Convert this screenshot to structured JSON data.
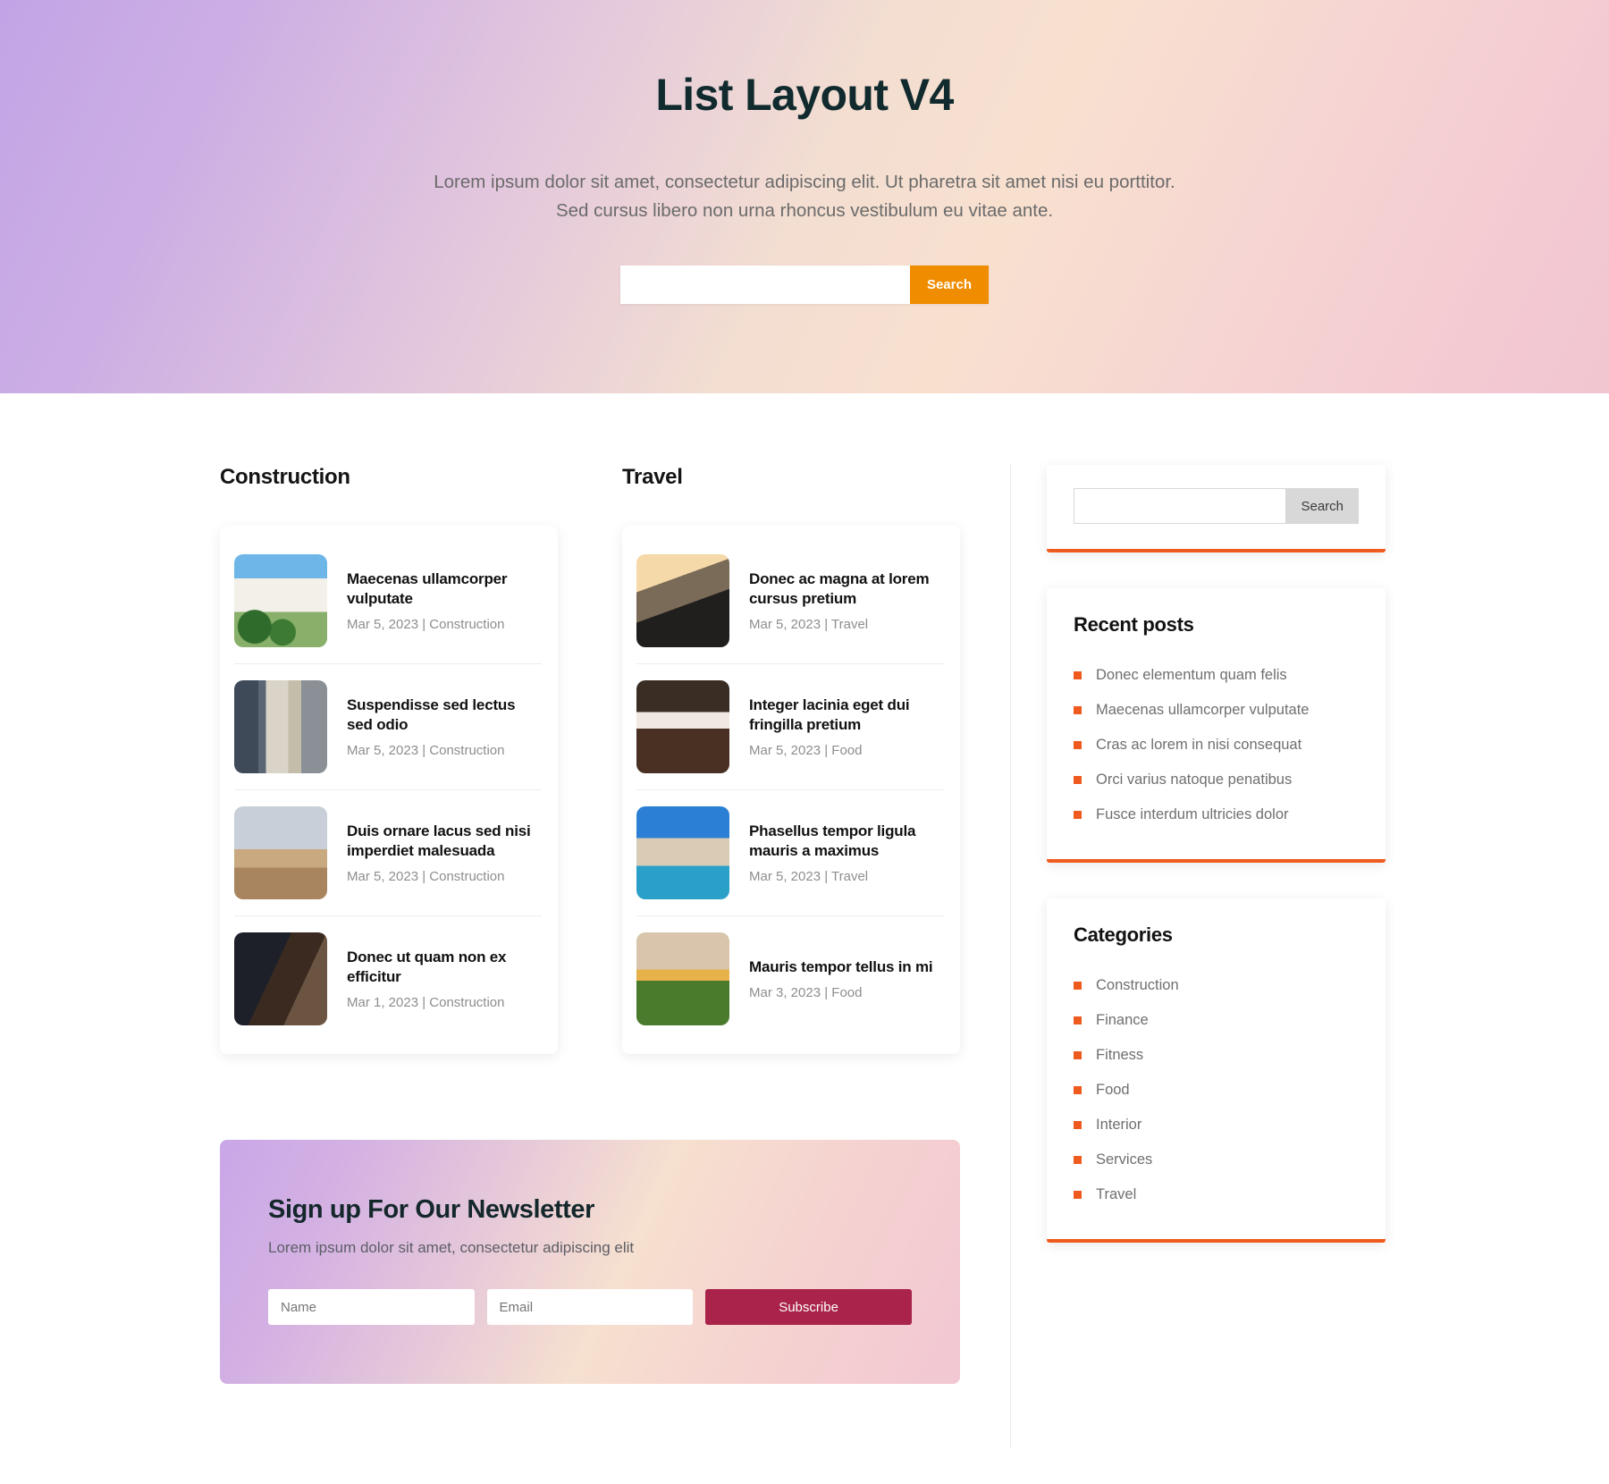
{
  "hero": {
    "title": "List Layout V4",
    "subtitle": "Lorem ipsum dolor sit amet, consectetur adipiscing elit. Ut pharetra sit amet nisi eu porttitor. Sed cursus libero non urna rhoncus vestibulum eu vitae ante.",
    "search": {
      "value": "",
      "placeholder": "",
      "button_label": "Search"
    },
    "colors": {
      "accent_orange": "#f08c00",
      "gradient_start": "#c2a4e6",
      "gradient_end": "#f2c6d1"
    }
  },
  "columns": [
    {
      "title": "Construction",
      "posts": [
        {
          "title": "Maecenas ullamcorper vulputate",
          "date": "Mar 5, 2023",
          "category": "Construction",
          "meta": "Mar 5, 2023 | Construction",
          "thumb": "house-thumb"
        },
        {
          "title": "Suspendisse sed lectus sed odio",
          "date": "Mar 5, 2023",
          "category": "Construction",
          "meta": "Mar 5, 2023 | Construction",
          "thumb": "building-thumb"
        },
        {
          "title": "Duis ornare lacus sed nisi imperdiet malesuada",
          "date": "Mar 5, 2023",
          "category": "Construction",
          "meta": "Mar 5, 2023 | Construction",
          "thumb": "crane-thumb"
        },
        {
          "title": "Donec ut quam non ex efficitur",
          "date": "Mar 1, 2023",
          "category": "Construction",
          "meta": "Mar 1, 2023 | Construction",
          "thumb": "leather-thumb"
        }
      ]
    },
    {
      "title": "Travel",
      "posts": [
        {
          "title": "Donec ac magna at lorem cursus pretium",
          "date": "Mar 5, 2023",
          "category": "Travel",
          "meta": "Mar 5, 2023 | Travel",
          "thumb": "driving-thumb"
        },
        {
          "title": "Integer lacinia eget dui fringilla pretium",
          "date": "Mar 5, 2023",
          "category": "Food",
          "meta": "Mar 5, 2023 | Food",
          "thumb": "chocolate-thumb"
        },
        {
          "title": "Phasellus tempor ligula mauris a maximus",
          "date": "Mar 5, 2023",
          "category": "Travel",
          "meta": "Mar 5, 2023 | Travel",
          "thumb": "venice-thumb"
        },
        {
          "title": "Mauris tempor tellus in mi",
          "date": "Mar 3, 2023",
          "category": "Food",
          "meta": "Mar 3, 2023 | Food",
          "thumb": "market-thumb"
        }
      ]
    }
  ],
  "newsletter": {
    "title": "Sign up For Our Newsletter",
    "subtitle": "Lorem ipsum dolor sit amet, consectetur adipiscing elit",
    "name_value": "",
    "name_placeholder": "Name",
    "email_value": "",
    "email_placeholder": "Email",
    "button_label": "Subscribe",
    "button_color": "#a9234a"
  },
  "sidebar": {
    "search": {
      "value": "",
      "placeholder": "",
      "button_label": "Search"
    },
    "recent_posts": {
      "title": "Recent posts",
      "items": [
        "Donec elementum quam felis",
        "Maecenas ullamcorper vulputate",
        "Cras ac lorem in nisi consequat",
        "Orci varius natoque penatibus",
        "Fusce interdum ultricies dolor"
      ]
    },
    "categories": {
      "title": "Categories",
      "items": [
        "Construction",
        "Finance",
        "Fitness",
        "Food",
        "Interior",
        "Services",
        "Travel"
      ]
    },
    "accent_color": "#ef5b1e"
  }
}
